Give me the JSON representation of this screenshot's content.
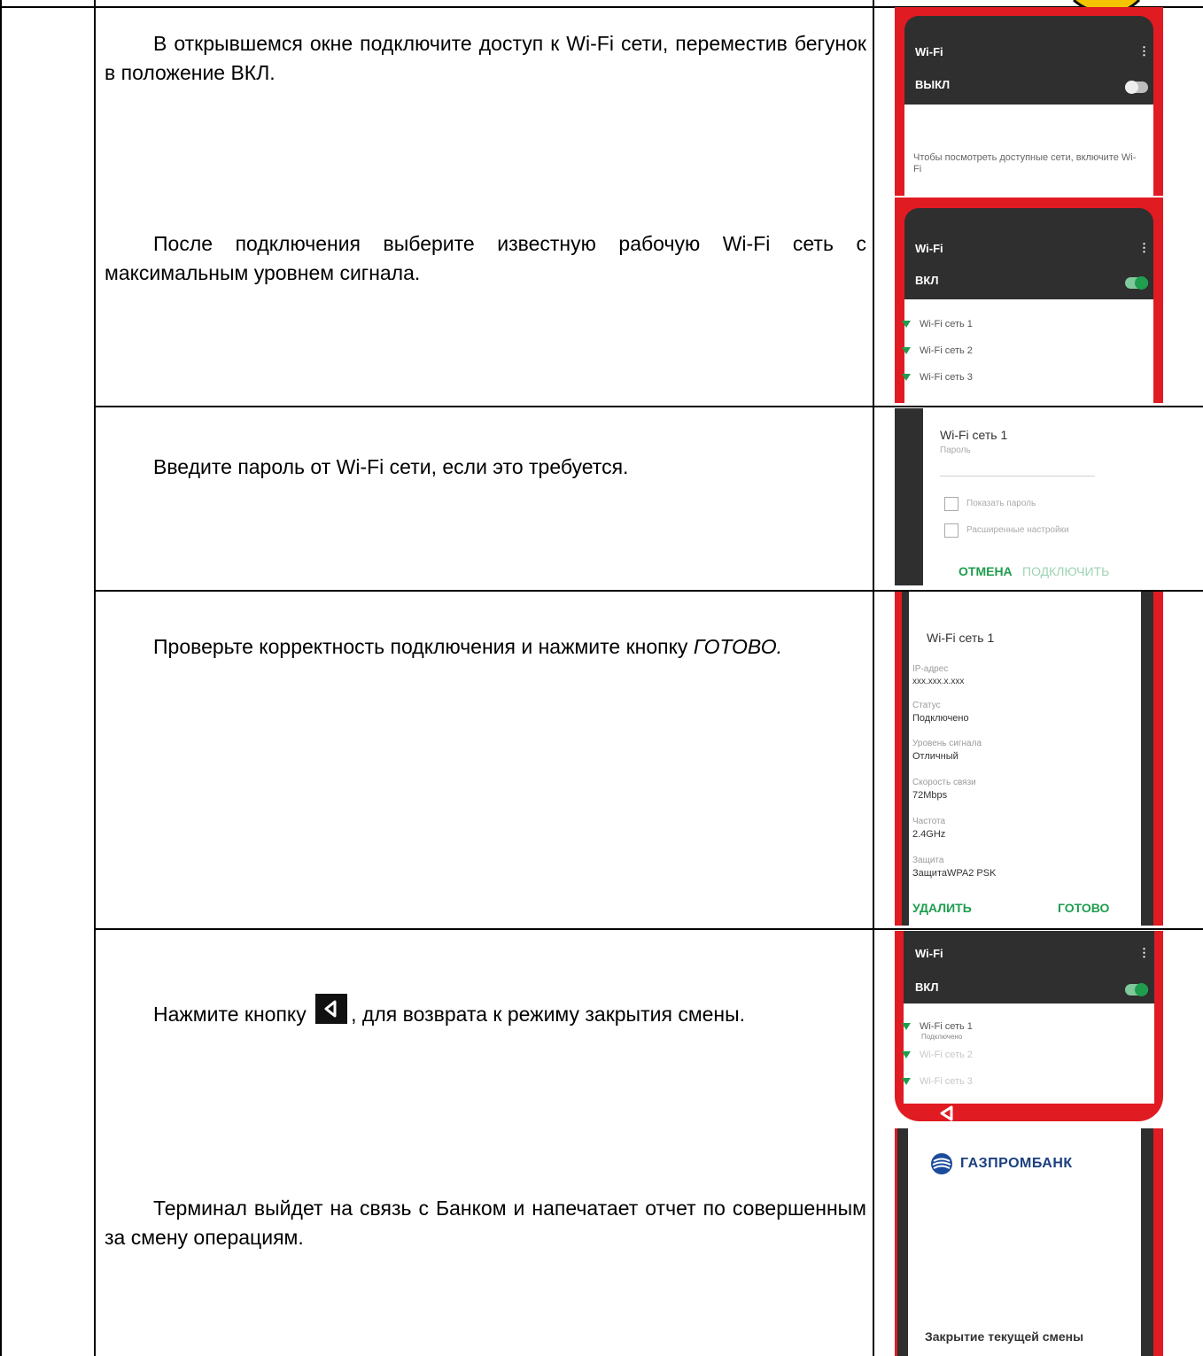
{
  "instructions": [
    "В открывшемся окне подключите доступ к Wi-Fi сети, переместив бегунок в положение ВКЛ.",
    "После подключения выберите известную рабочую Wi-Fi сеть с максимальным уровнем сигнала.",
    "Введите пароль от Wi-Fi сети, если это требуется.",
    "Проверьте корректность подключения и нажмите кнопку",
    "ГОТОВО.",
    "Нажмите кнопку",
    ", для возврата к режиму закрытия смены.",
    "Терминал выйдет на связь с Банком и напечатает отчет по совершенным за смену операциям."
  ],
  "screen1": {
    "title": "Wi-Fi",
    "menu": "⋮",
    "state": "ВЫКЛ",
    "message": "Чтобы посмотреть доступные сети, включите Wi-Fi"
  },
  "screen2": {
    "title": "Wi-Fi",
    "menu": "⋮",
    "state": "ВКЛ",
    "networks": [
      "Wi-Fi сеть 1",
      "Wi-Fi сеть 2",
      "Wi-Fi сеть 3"
    ]
  },
  "screen3": {
    "network": "Wi-Fi сеть 1",
    "password_label": "Пароль",
    "show_password": "Показать пароль",
    "advanced": "Расширенные настройки",
    "cancel": "ОТМЕНА",
    "connect": "ПОДКЛЮЧИТЬ"
  },
  "screen4": {
    "network": "Wi-Fi сеть 1",
    "fields": [
      {
        "k": "IP-адрес",
        "v": "xxx.xxx.x.xxx"
      },
      {
        "k": "Статус",
        "v": "Подключено"
      },
      {
        "k": "Уровень сигнала",
        "v": "Отличный"
      },
      {
        "k": "Скорость связи",
        "v": "72Mbps"
      },
      {
        "k": "Частота",
        "v": "2.4GHz"
      },
      {
        "k": "Защита",
        "v": "ЗащитаWPA2 PSK"
      }
    ],
    "delete": "УДАЛИТЬ",
    "done": "ГОТОВО"
  },
  "screen5": {
    "title": "Wi-Fi",
    "menu": "⋮",
    "state": "ВКЛ",
    "networks": [
      "Wi-Fi сеть 1",
      "Wi-Fi сеть 2",
      "Wi-Fi сеть 3"
    ],
    "connected": "Подключено"
  },
  "screen6": {
    "bank": "ГАЗПРОМБАНК",
    "message": "Закрытие текущей смены"
  },
  "colors": {
    "red": "#e01b22",
    "dark": "#2f2f2f",
    "green": "#1f9d4e"
  }
}
